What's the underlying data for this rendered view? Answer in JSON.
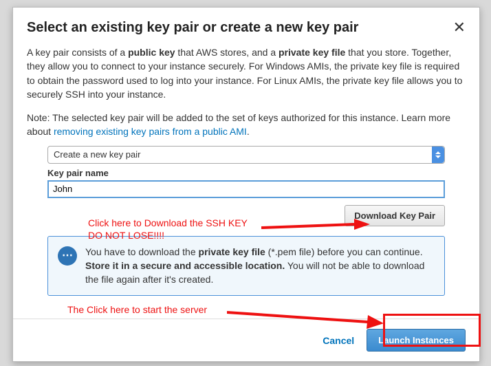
{
  "modal": {
    "title": "Select an existing key pair or create a new key pair",
    "description_parts": {
      "p1a": "A key pair consists of a ",
      "p1b": "public key",
      "p1c": " that AWS stores, and a ",
      "p1d": "private key file",
      "p1e": " that you store. Together, they allow you to connect to your instance securely. For Windows AMIs, the private key file is required to obtain the password used to log into your instance. For Linux AMIs, the private key file allows you to securely SSH into your instance."
    },
    "note_parts": {
      "n1": "Note: The selected key pair will be added to the set of keys authorized for this instance. Learn more about ",
      "link": "removing existing key pairs from a public AMI",
      "n2": "."
    },
    "select_value": "Create a new key pair",
    "field_label": "Key pair name",
    "input_value": "John",
    "download_button": "Download Key Pair",
    "info": {
      "i1": "You have to download the ",
      "i2": "private key file",
      "i3": " (*.pem file) before you can continue. ",
      "i4": "Store it in a secure and accessible location.",
      "i5": " You will not be able to download the file again after it's created."
    },
    "cancel": "Cancel",
    "launch": "Launch Instances"
  },
  "annotations": {
    "a1_line1": "Click here to Download the SSH KEY",
    "a1_line2": "DO NOT LOSE!!!!",
    "a2": "The Click here to start the server"
  }
}
